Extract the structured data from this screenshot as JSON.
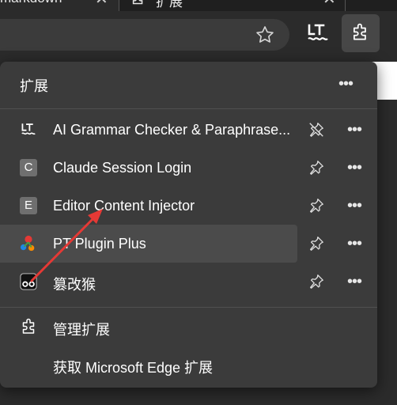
{
  "tabs": [
    {
      "title": "markdown",
      "close": "✕"
    },
    {
      "title": "扩展",
      "close": "✕"
    }
  ],
  "panel": {
    "title": "扩展",
    "more": "•••",
    "extensions": [
      {
        "name": "AI Grammar Checker & Paraphrase...",
        "icon": "languagetool-icon",
        "pinned": true,
        "more": "•••"
      },
      {
        "name": "Claude Session Login",
        "letter": "C",
        "pinned": false,
        "more": "•••"
      },
      {
        "name": "Editor Content Injector",
        "letter": "E",
        "pinned": false,
        "more": "•••"
      },
      {
        "name": "PT Plugin Plus",
        "icon": "pt-plugin-icon",
        "pinned": false,
        "more": "•••"
      },
      {
        "name": "篡改猴",
        "icon": "tampermonkey-icon",
        "pinned": false,
        "more": "•••"
      }
    ],
    "footer": {
      "manage": "管理扩展",
      "get": "获取 Microsoft Edge 扩展"
    }
  },
  "colors": {
    "panel_bg": "#3b3b3b",
    "hover_row": "#4b4b4b",
    "arrow": "#e53935",
    "page_bg": "#2b2b2b"
  }
}
